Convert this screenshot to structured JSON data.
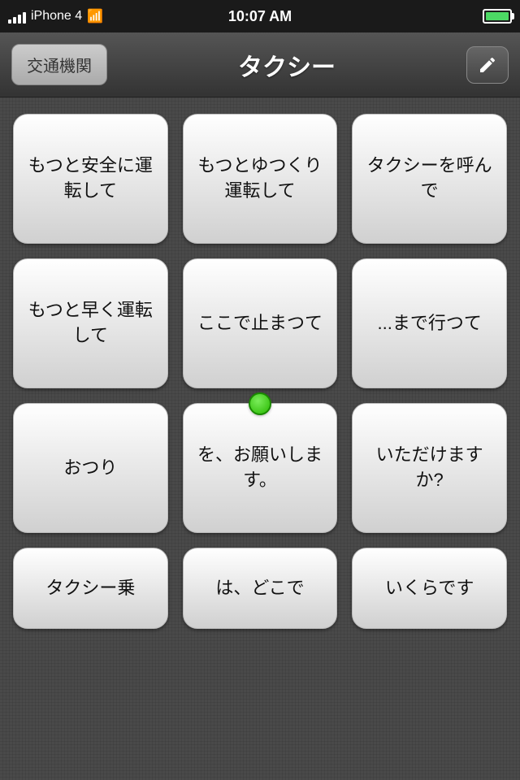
{
  "statusBar": {
    "carrier": "iPhone 4",
    "time": "10:07 AM",
    "wifi": "wifi",
    "battery": "full"
  },
  "navBar": {
    "backLabel": "交通機関",
    "title": "タクシー",
    "editIcon": "pencil-icon"
  },
  "phrases": [
    {
      "id": "card-1",
      "text": "もつと安全に運転して",
      "hasDot": false
    },
    {
      "id": "card-2",
      "text": "もつとゆつくり運転して",
      "hasDot": false
    },
    {
      "id": "card-3",
      "text": "タクシーを呼んで",
      "hasDot": false
    },
    {
      "id": "card-4",
      "text": "もつと早く運転して",
      "hasDot": false
    },
    {
      "id": "card-5",
      "text": "ここで止まつて",
      "hasDot": false
    },
    {
      "id": "card-6",
      "text": "...まで行つて",
      "hasDot": false
    },
    {
      "id": "card-7",
      "text": "おつり",
      "hasDot": false
    },
    {
      "id": "card-8",
      "text": "を、お願いします。",
      "hasDot": true
    },
    {
      "id": "card-9",
      "text": "いただけますか?",
      "hasDot": false
    },
    {
      "id": "card-10",
      "text": "タクシー乗",
      "hasDot": false,
      "partial": true
    },
    {
      "id": "card-11",
      "text": "は、どこで",
      "hasDot": false,
      "partial": true
    },
    {
      "id": "card-12",
      "text": "いくらです",
      "hasDot": false,
      "partial": true
    }
  ]
}
